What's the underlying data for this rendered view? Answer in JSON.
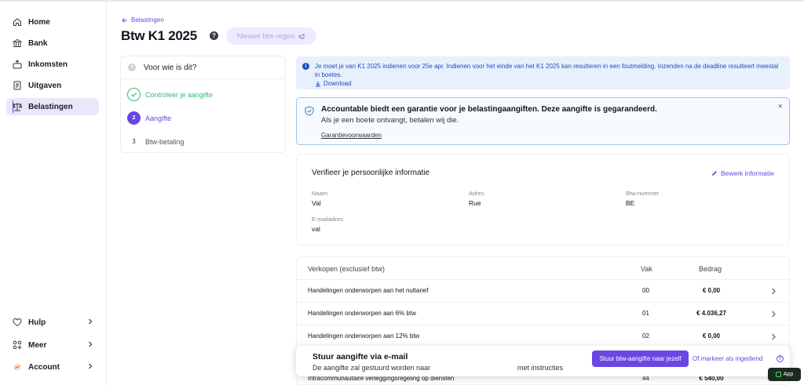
{
  "sidebar": {
    "items": [
      {
        "label": "Home",
        "icon": "home-icon"
      },
      {
        "label": "Bank",
        "icon": "bank-icon"
      },
      {
        "label": "Inkomsten",
        "icon": "income-icon"
      },
      {
        "label": "Uitgaven",
        "icon": "receipt-icon"
      },
      {
        "label": "Belastingen",
        "icon": "scale-icon",
        "active": true
      }
    ],
    "bottom_items": [
      {
        "label": "Hulp",
        "icon": "heart-icon"
      },
      {
        "label": "Meer",
        "icon": "grid-icon"
      },
      {
        "label": "Account",
        "icon": "account-icon"
      }
    ]
  },
  "header": {
    "breadcrumb": "Belastingen",
    "title": "Btw K1 2025",
    "help": "?",
    "rules_button": "Nieuwe btw-regels"
  },
  "steps": {
    "question": "Voor wie is dit?",
    "items": [
      {
        "number": "",
        "label": "Controleer je aangifte",
        "state": "done"
      },
      {
        "number": "2",
        "label": "Aangifte",
        "state": "active"
      },
      {
        "number": "3",
        "label": "Btw-betaling",
        "state": "todo"
      }
    ]
  },
  "info_banner": {
    "text": "Je moet je van K1 2025 indienen voor 25e apr. Indienen voor het einde van het K1 2025 kan resulteren in een foutmelding. Inzenden na de deadline resulteert meestal in boetes.",
    "download": "Download"
  },
  "guarantee": {
    "title": "Accountable biedt een garantie voor je belastingaangiften. Deze aangifte is gegarandeerd.",
    "subtitle": "Als je een boete ontvangt, betalen wij die.",
    "link": "Garantievoorwaarden",
    "close": "×"
  },
  "personal": {
    "title": "Verifieer je persoonlijke informatie",
    "edit": "Bewerk informatie",
    "fields": {
      "name_label": "Naam",
      "name_value": "Val",
      "address_label": "Adres",
      "address_value": "Rue",
      "vat_label": "Btw-nummer",
      "vat_value": "BE",
      "email_label": "E-mailadres",
      "email_value": "val"
    }
  },
  "sales": {
    "headers": {
      "description": "Verkopen (exclusief btw)",
      "vak": "Vak",
      "bedrag": "Bedrag"
    },
    "rows": [
      {
        "description": "Handelingen onderworpen aan het nultarief",
        "vak": "00",
        "bedrag": "€ 0,00"
      },
      {
        "description": "Handelingen onderworpen aan 6% btw",
        "vak": "01",
        "bedrag": "€ 4.036,27"
      },
      {
        "description": "Handelingen onderworpen aan 12% btw",
        "vak": "02",
        "bedrag": "€ 0,00"
      },
      {
        "description": "Intracommunautaire verleggingsregeling op diensten",
        "vak": "44",
        "bedrag": "€ 540,00"
      }
    ]
  },
  "email_bar": {
    "title": "Stuur aangifte via e-mail",
    "text_start": "De aangifte zal gestuurd worden naar",
    "text_end": "met instructies",
    "send_button": "Stuur btw-aangifte naar jezelf",
    "mark_link": "Of markeer als ingediend",
    "help": "?"
  },
  "app_badge": "App",
  "colors": {
    "accent": "#6b46e5",
    "success": "#2fbf71",
    "info": "#1d4fb8",
    "active_nav_bg": "#ebe6fb"
  }
}
